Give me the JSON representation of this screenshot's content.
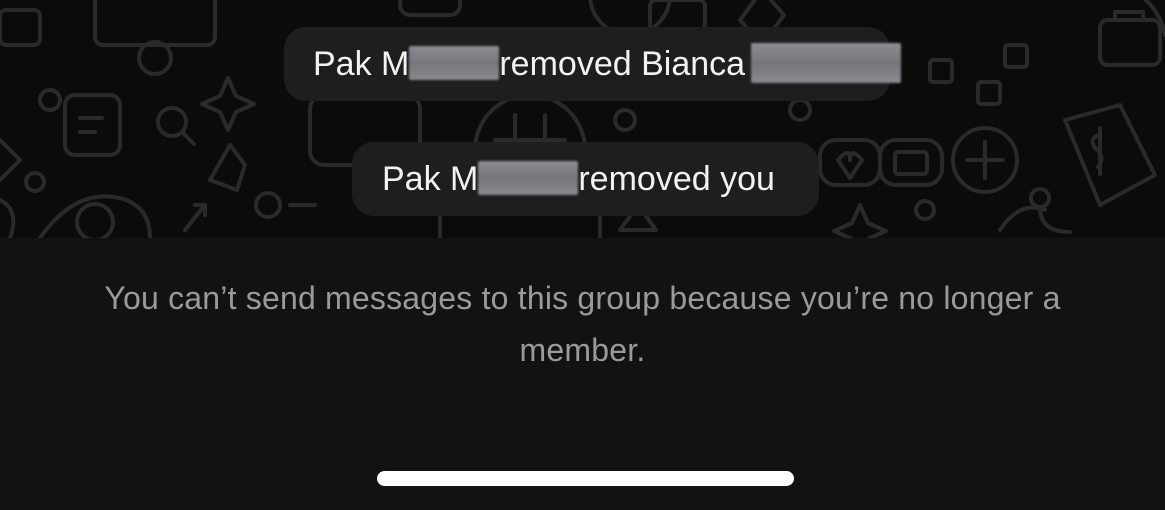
{
  "chat": {
    "messages": [
      {
        "prefix": "Pak M",
        "middle": "removed Bianca",
        "suffix": ""
      },
      {
        "prefix": "Pak M",
        "middle": "removed you",
        "suffix": ""
      }
    ]
  },
  "composer": {
    "notice": "You can’t send messages to this group because you’re no longer a member."
  },
  "colors": {
    "chat_background": "#0b0b0b",
    "bubble": "#1e1e1e",
    "bubble_text": "#f2f2f2",
    "notice_text": "#9a9a9a",
    "panel": "#121212",
    "home_indicator": "#ffffff"
  }
}
